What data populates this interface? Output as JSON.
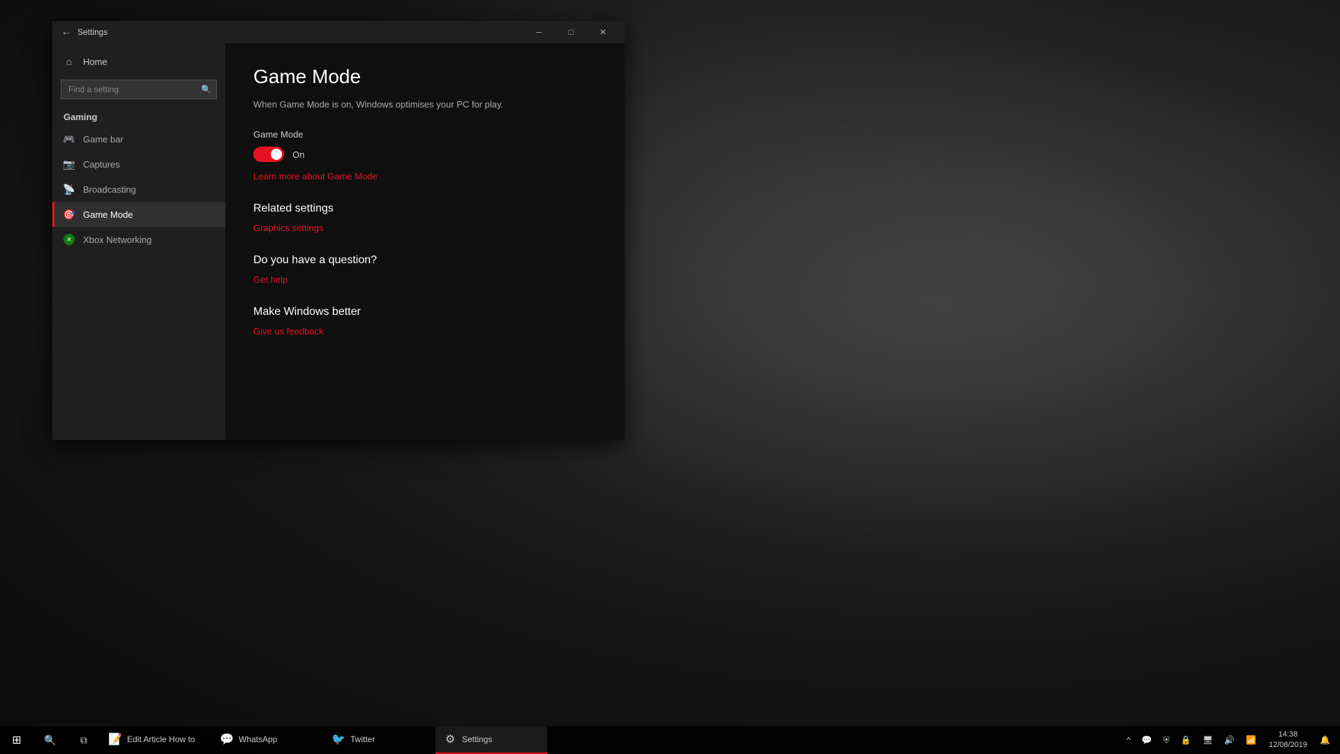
{
  "desktop": {
    "bg_description": "dark Fallout game wallpaper"
  },
  "window": {
    "title": "Settings",
    "back_label": "←",
    "minimize_label": "─",
    "maximize_label": "□",
    "close_label": "✕"
  },
  "sidebar": {
    "home_label": "Home",
    "search_placeholder": "Find a setting",
    "section_title": "Gaming",
    "items": [
      {
        "id": "game-bar",
        "label": "Game bar",
        "icon": "🎮"
      },
      {
        "id": "captures",
        "label": "Captures",
        "icon": "📷"
      },
      {
        "id": "broadcasting",
        "label": "Broadcasting",
        "icon": "📡"
      },
      {
        "id": "game-mode",
        "label": "Game Mode",
        "icon": "🎯",
        "active": true
      },
      {
        "id": "xbox-networking",
        "label": "Xbox Networking",
        "icon": "✕"
      }
    ]
  },
  "main": {
    "title": "Game Mode",
    "subtitle": "When Game Mode is on, Windows optimises your PC for play.",
    "toggle_section_label": "Game Mode",
    "toggle_state": "On",
    "toggle_on": true,
    "learn_more_link": "Learn more about Game Mode",
    "related_settings_heading": "Related settings",
    "graphics_settings_link": "Graphics settings",
    "question_heading": "Do you have a question?",
    "get_help_link": "Get help",
    "make_better_heading": "Make Windows better",
    "feedback_link": "Give us feedback"
  },
  "taskbar": {
    "start_icon": "⊞",
    "search_icon": "🔍",
    "taskview_icon": "⧉",
    "apps": [
      {
        "id": "edit-article",
        "label": "Edit Article How to",
        "icon": "📝",
        "active": false
      },
      {
        "id": "whatsapp",
        "label": "WhatsApp",
        "icon": "💬",
        "active": false
      },
      {
        "id": "twitter",
        "label": "Twitter",
        "icon": "🐦",
        "active": false
      },
      {
        "id": "settings",
        "label": "Settings",
        "icon": "⚙",
        "active": true
      }
    ],
    "sys_icons": [
      "^",
      "💬",
      "⛨",
      "🔒",
      "🖥",
      "🔊",
      "📶"
    ],
    "time": "14:38",
    "date": "12/08/2019",
    "notification_icon": "🔔"
  }
}
